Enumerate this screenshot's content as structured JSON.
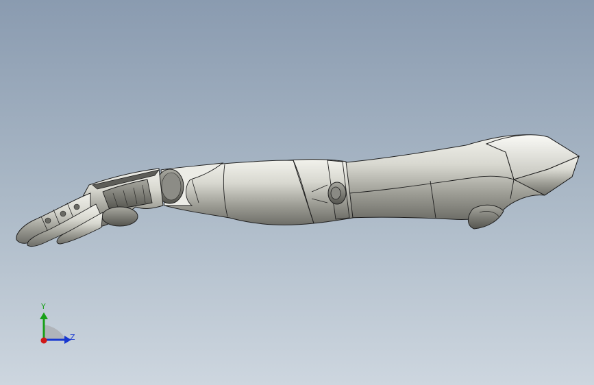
{
  "viewport": {
    "background_top": "#8a9bb0",
    "background_bottom": "#cdd6df",
    "model_name": "robotic-arm-model",
    "model_color": "#c9c9c1",
    "edge_color": "#1e1e1e"
  },
  "triad": {
    "y_label": "Y",
    "z_label": "Z",
    "y_color": "#18a018",
    "z_color": "#1838d0",
    "x_color": "#d01818"
  }
}
